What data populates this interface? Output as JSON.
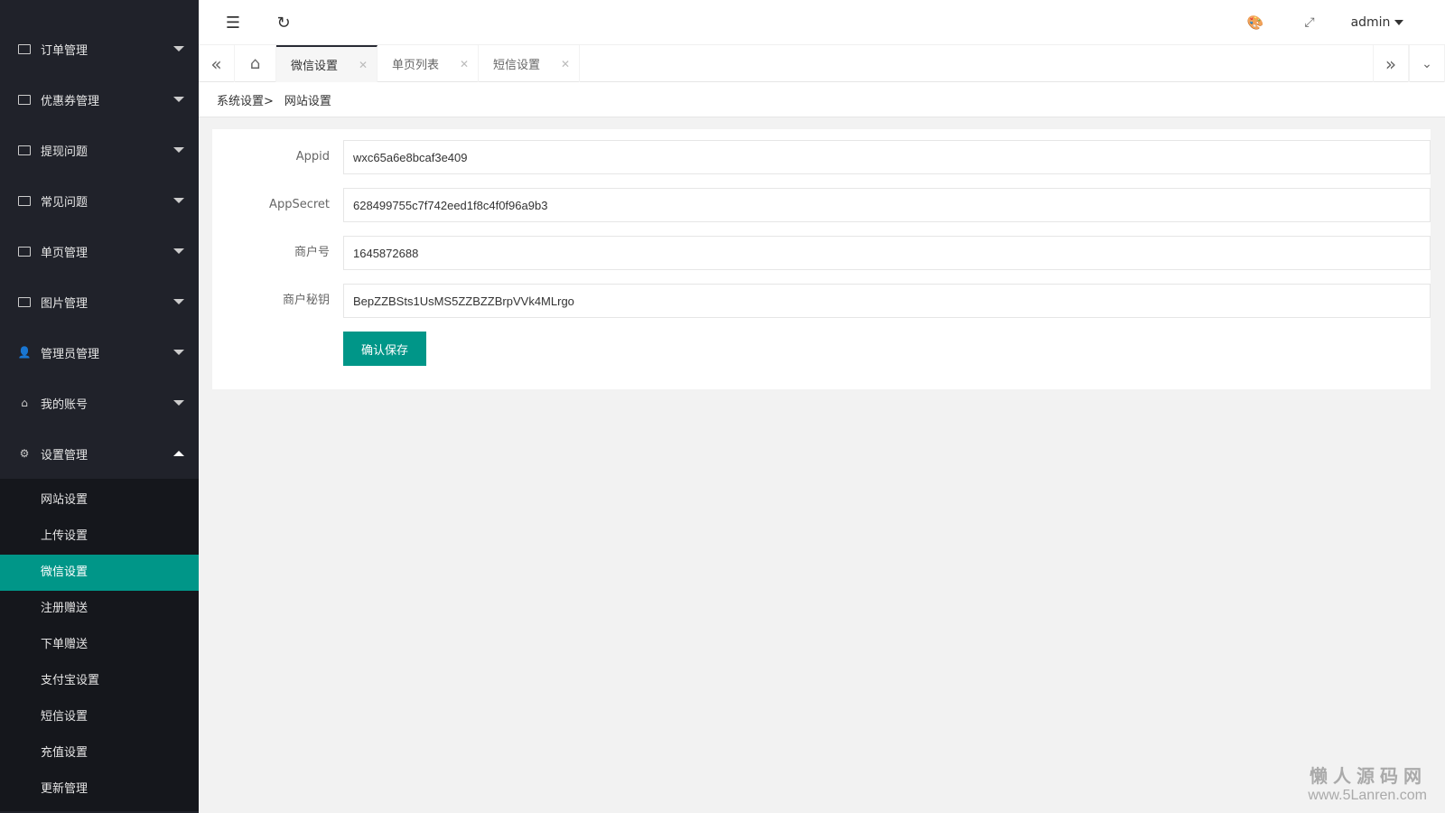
{
  "sidebar": {
    "items": [
      {
        "label": "订单管理",
        "icon": "image-icon"
      },
      {
        "label": "优惠券管理",
        "icon": "image-icon"
      },
      {
        "label": "提现问题",
        "icon": "image-icon"
      },
      {
        "label": "常见问题",
        "icon": "image-icon"
      },
      {
        "label": "单页管理",
        "icon": "image-icon"
      },
      {
        "label": "图片管理",
        "icon": "image-icon"
      },
      {
        "label": "管理员管理",
        "icon": "user-icon"
      },
      {
        "label": "我的账号",
        "icon": "home-icon"
      },
      {
        "label": "设置管理",
        "icon": "gear-icon"
      }
    ],
    "submenu": [
      "网站设置",
      "上传设置",
      "微信设置",
      "注册赠送",
      "下单赠送",
      "支付宝设置",
      "短信设置",
      "充值设置",
      "更新管理"
    ],
    "active_sub": "微信设置"
  },
  "topbar": {
    "user": "admin"
  },
  "tabs": [
    {
      "label": "微信设置",
      "active": true
    },
    {
      "label": "单页列表"
    },
    {
      "label": "短信设置"
    }
  ],
  "breadcrumb": {
    "parent": "系统设置>",
    "current": "网站设置"
  },
  "form": {
    "fields": [
      {
        "label": "Appid",
        "value": "wxc65a6e8bcaf3e409"
      },
      {
        "label": "AppSecret",
        "value": "628499755c7f742eed1f8c4f0f96a9b3"
      },
      {
        "label": "商户号",
        "value": "1645872688"
      },
      {
        "label": "商户秘钥",
        "value": "BepZZBSts1UsMS5ZZBZZBrpVVk4MLrgo"
      }
    ],
    "submit": "确认保存"
  },
  "watermark": {
    "line1": "懒人源码网",
    "line2": "www.5Lanren.com"
  },
  "colors": {
    "accent": "#009688",
    "sidebar": "#20222a"
  }
}
